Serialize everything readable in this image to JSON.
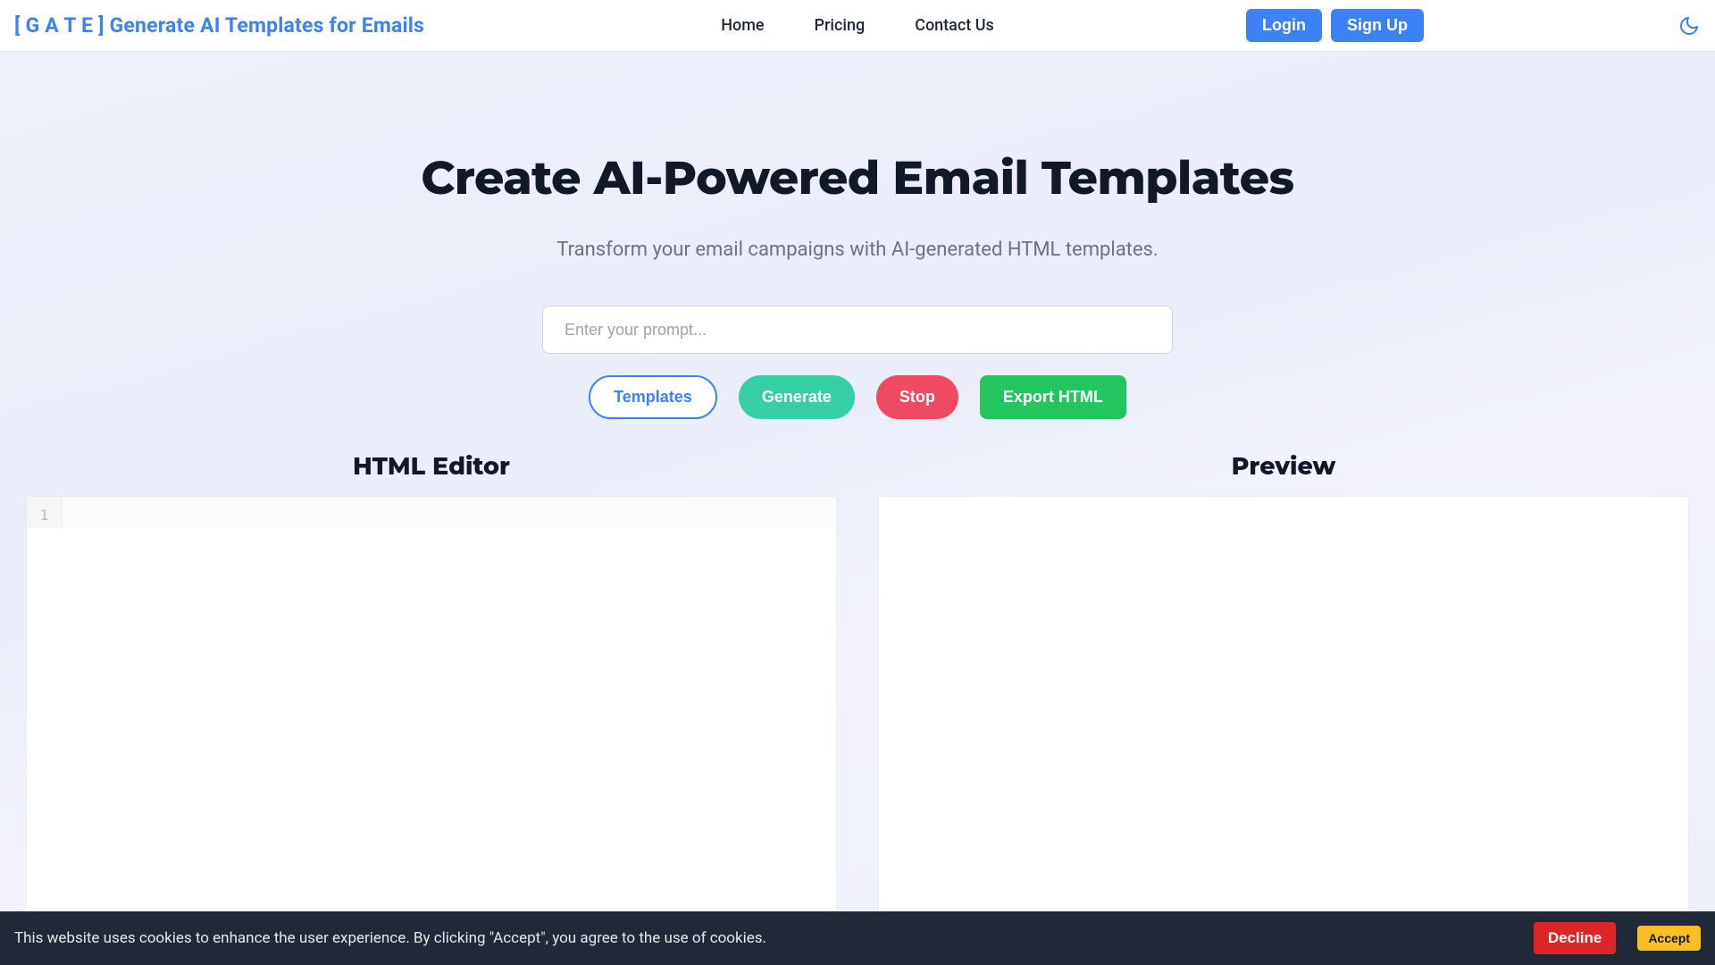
{
  "header": {
    "logo": "[ G A T E ] Generate AI Templates for Emails",
    "nav": {
      "home": "Home",
      "pricing": "Pricing",
      "contact": "Contact Us"
    },
    "auth": {
      "login": "Login",
      "signup": "Sign Up"
    }
  },
  "hero": {
    "title": "Create AI-Powered Email Templates",
    "subtitle": "Transform your email campaigns with AI-generated HTML templates.",
    "prompt_placeholder": "Enter your prompt...",
    "buttons": {
      "templates": "Templates",
      "generate": "Generate",
      "stop": "Stop",
      "export": "Export HTML"
    }
  },
  "panels": {
    "editor_title": "HTML Editor",
    "preview_title": "Preview",
    "editor_line_numbers": [
      "1"
    ]
  },
  "cookie": {
    "text": "This website uses cookies to enhance the user experience. By clicking \"Accept\", you agree to the use of cookies.",
    "decline": "Decline",
    "accept": "Accept"
  }
}
